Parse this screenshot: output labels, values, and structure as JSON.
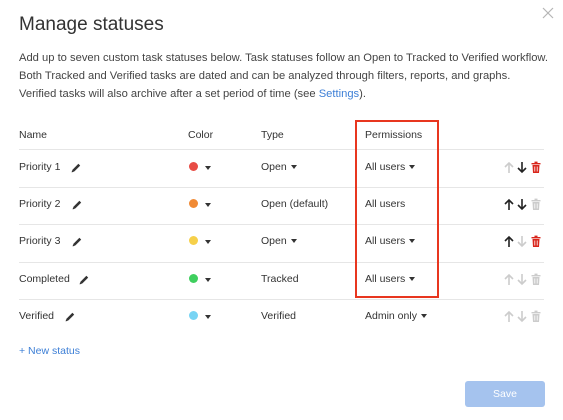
{
  "dialog": {
    "title": "Manage statuses",
    "description_before_link": "Add up to seven custom task statuses below. Task statuses follow an Open to Tracked to Verified workflow. Both Tracked and Verified tasks are dated and can be analyzed through filters, reports, and graphs. Verified tasks will also archive after a set period of time (see ",
    "description_link": "Settings",
    "description_after_link": ").",
    "close_icon": "close-icon",
    "highlight_color": "#e8361f"
  },
  "table": {
    "headers": {
      "name": "Name",
      "color": "Color",
      "type": "Type",
      "permissions": "Permissions"
    },
    "rows": [
      {
        "name": "Priority 1",
        "color": "#e84c45",
        "type": "Open",
        "type_dropdown": true,
        "permissions": "All users",
        "permissions_dropdown": true,
        "up_enabled": false,
        "down_enabled": true,
        "delete_enabled": true
      },
      {
        "name": "Priority 2",
        "color": "#f08a35",
        "type": "Open (default)",
        "type_dropdown": false,
        "permissions": "All users",
        "permissions_dropdown": false,
        "up_enabled": true,
        "down_enabled": true,
        "delete_enabled": false
      },
      {
        "name": "Priority 3",
        "color": "#f6d04a",
        "type": "Open",
        "type_dropdown": true,
        "permissions": "All users",
        "permissions_dropdown": true,
        "up_enabled": true,
        "down_enabled": false,
        "delete_enabled": true
      },
      {
        "name": "Completed",
        "color": "#3fcf5e",
        "type": "Tracked",
        "type_dropdown": false,
        "permissions": "All users",
        "permissions_dropdown": true,
        "up_enabled": false,
        "down_enabled": false,
        "delete_enabled": false
      },
      {
        "name": "Verified",
        "color": "#78d4f4",
        "type": "Verified",
        "type_dropdown": false,
        "permissions": "Admin only",
        "permissions_dropdown": true,
        "up_enabled": false,
        "down_enabled": false,
        "delete_enabled": false
      }
    ]
  },
  "footer": {
    "new_status_label": "+ New status",
    "save_label": "Save",
    "save_color": "#a5c3ee"
  },
  "colors": {
    "accent": "#3d7fd6",
    "delete_red": "#d9261c",
    "disabled": "#cccccc"
  }
}
